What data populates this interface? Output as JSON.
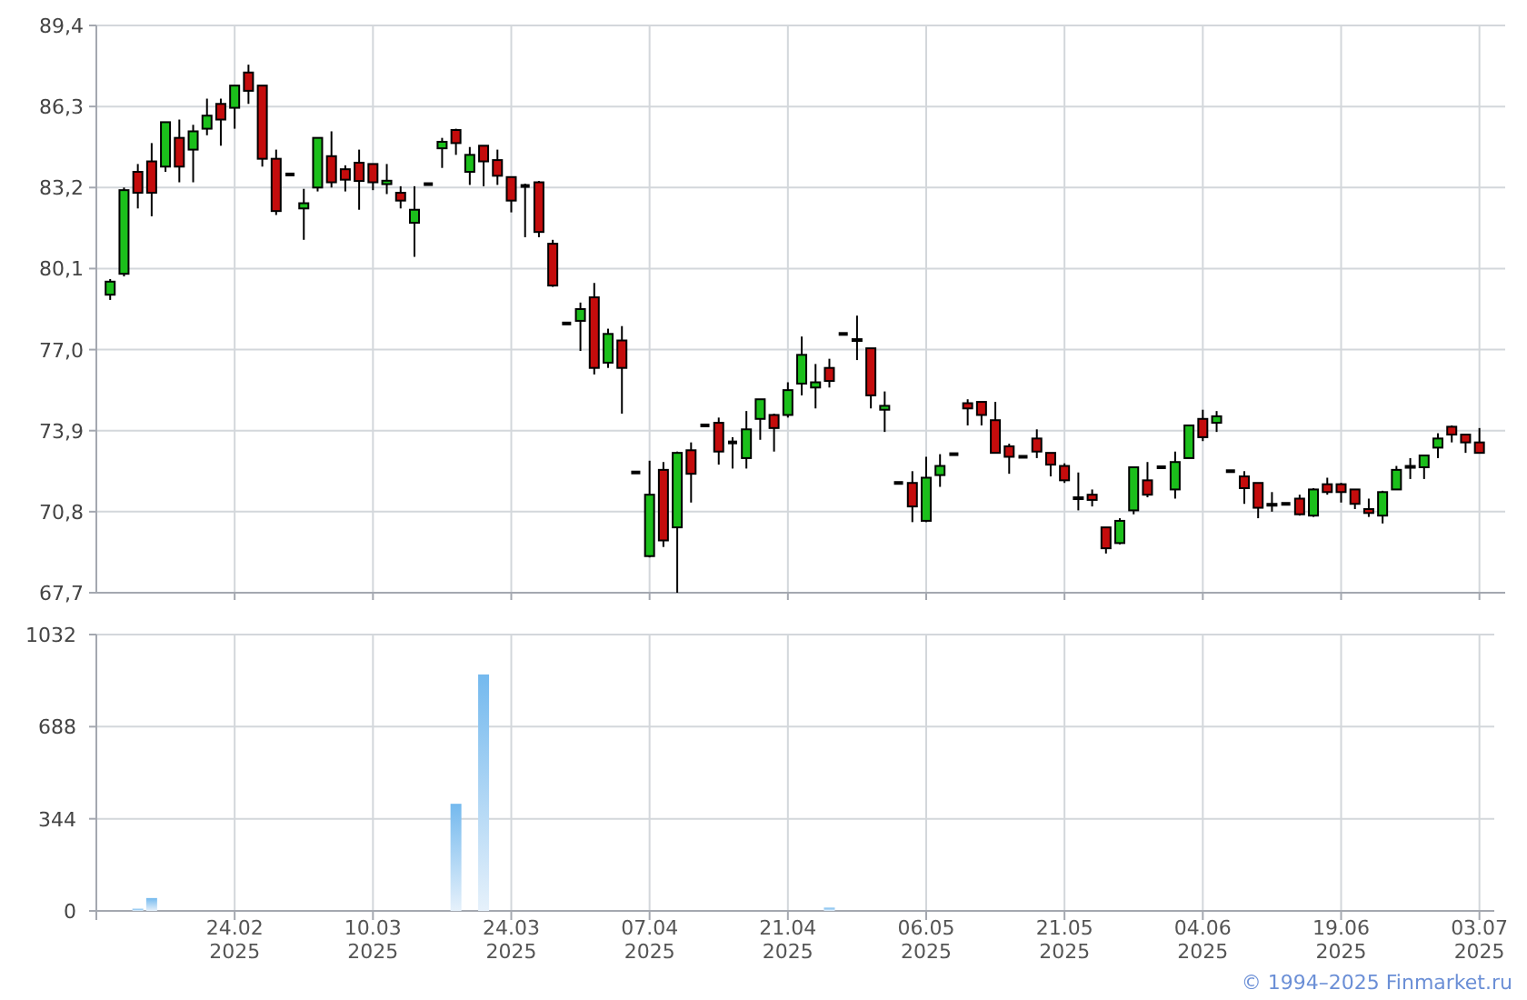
{
  "price_chart": {
    "chart_data": {
      "type": "candlestick",
      "grid": true,
      "categories": [
        null,
        null,
        null,
        null,
        null,
        null,
        null,
        null,
        null,
        null,
        null,
        null,
        null,
        null,
        null,
        null,
        null,
        null,
        null,
        null,
        null,
        null,
        null,
        null,
        null,
        null,
        null,
        null,
        null,
        null,
        null,
        null,
        null,
        null,
        null,
        null,
        null,
        null,
        null,
        null,
        null,
        null,
        null,
        null,
        null,
        null,
        null,
        null,
        null,
        null,
        null,
        null,
        null,
        null,
        null,
        null,
        null,
        null,
        null,
        null,
        null,
        null,
        null,
        null,
        null,
        null,
        null,
        null,
        null,
        null,
        null,
        null,
        null,
        null,
        null,
        null,
        null,
        null,
        null,
        null,
        null,
        null,
        null,
        null,
        null,
        null,
        null,
        null,
        null,
        null,
        null,
        null,
        null,
        null,
        null,
        null,
        null,
        null,
        null,
        null
      ],
      "ohlc": [
        [
          79.1,
          79.7,
          78.9,
          79.6
        ],
        [
          79.9,
          83.2,
          79.8,
          83.1
        ],
        [
          83.8,
          84.1,
          82.4,
          83.0
        ],
        [
          84.2,
          84.9,
          82.1,
          83.0
        ],
        [
          84.0,
          85.7,
          83.8,
          85.7
        ],
        [
          85.1,
          85.8,
          83.4,
          84.0
        ],
        [
          84.65,
          85.6,
          83.4,
          85.35
        ],
        [
          85.45,
          86.6,
          85.2,
          85.95
        ],
        [
          86.4,
          86.6,
          84.8,
          85.8
        ],
        [
          86.25,
          87.1,
          85.45,
          87.1
        ],
        [
          87.6,
          87.9,
          86.4,
          86.9
        ],
        [
          87.1,
          87.1,
          84.0,
          84.3
        ],
        [
          84.3,
          84.65,
          82.15,
          82.3
        ],
        [
          83.7,
          83.7,
          83.7,
          83.7
        ],
        [
          82.4,
          83.15,
          81.2,
          82.6
        ],
        [
          83.2,
          85.1,
          83.05,
          85.1
        ],
        [
          84.4,
          85.35,
          83.2,
          83.4
        ],
        [
          83.9,
          84.05,
          83.05,
          83.5
        ],
        [
          84.15,
          84.65,
          82.35,
          83.45
        ],
        [
          84.1,
          84.1,
          83.1,
          83.4
        ],
        [
          83.33,
          84.1,
          82.95,
          83.46
        ],
        [
          83.0,
          83.25,
          82.4,
          82.7
        ],
        [
          81.85,
          83.25,
          80.55,
          82.35
        ],
        [
          83.33,
          83.33,
          83.33,
          83.33
        ],
        [
          84.7,
          85.1,
          83.95,
          84.95
        ],
        [
          85.4,
          85.45,
          84.45,
          84.9
        ],
        [
          83.8,
          84.75,
          83.3,
          84.45
        ],
        [
          84.8,
          84.8,
          83.25,
          84.2
        ],
        [
          84.25,
          84.65,
          83.3,
          83.65
        ],
        [
          83.6,
          83.6,
          82.25,
          82.7
        ],
        [
          83.26,
          83.35,
          81.3,
          83.26
        ],
        [
          83.4,
          83.45,
          81.3,
          81.5
        ],
        [
          81.05,
          81.2,
          79.4,
          79.45
        ],
        [
          78.0,
          78.0,
          78.0,
          78.0
        ],
        [
          78.1,
          78.8,
          76.95,
          78.55
        ],
        [
          79.0,
          79.55,
          76.05,
          76.3
        ],
        [
          76.5,
          77.8,
          76.3,
          77.6
        ],
        [
          77.35,
          77.9,
          74.55,
          76.3
        ],
        [
          72.3,
          72.3,
          72.3,
          72.3
        ],
        [
          69.1,
          72.75,
          69.05,
          71.45
        ],
        [
          72.4,
          72.7,
          69.45,
          69.7
        ],
        [
          70.2,
          73.1,
          67.7,
          73.05
        ],
        [
          73.15,
          73.45,
          71.15,
          72.25
        ],
        [
          74.1,
          74.1,
          74.1,
          74.1
        ],
        [
          74.2,
          74.4,
          72.6,
          73.1
        ],
        [
          73.42,
          73.65,
          72.45,
          73.45
        ],
        [
          72.85,
          74.65,
          72.45,
          73.95
        ],
        [
          74.35,
          75.1,
          73.55,
          75.1
        ],
        [
          74.5,
          74.55,
          73.1,
          74.0
        ],
        [
          74.5,
          75.75,
          74.4,
          75.45
        ],
        [
          75.7,
          77.5,
          75.25,
          76.8
        ],
        [
          75.55,
          76.45,
          74.75,
          75.75
        ],
        [
          76.3,
          76.65,
          75.55,
          75.8
        ],
        [
          77.6,
          77.6,
          77.6,
          77.6
        ],
        [
          77.4,
          78.3,
          76.6,
          77.35
        ],
        [
          77.05,
          77.05,
          74.75,
          75.25
        ],
        [
          74.7,
          75.4,
          73.85,
          74.85
        ],
        [
          71.9,
          71.9,
          71.9,
          71.9
        ],
        [
          71.9,
          72.35,
          70.4,
          71.0
        ],
        [
          70.45,
          72.9,
          70.4,
          72.1
        ],
        [
          72.2,
          73.0,
          71.75,
          72.55
        ],
        [
          73.0,
          73.0,
          73.0,
          73.0
        ],
        [
          74.95,
          75.1,
          74.1,
          74.75
        ],
        [
          75.0,
          75.0,
          74.1,
          74.5
        ],
        [
          74.3,
          75.0,
          73.05,
          73.05
        ],
        [
          73.3,
          73.4,
          72.25,
          72.9
        ],
        [
          72.9,
          72.9,
          72.9,
          72.9
        ],
        [
          73.6,
          73.95,
          72.85,
          73.1
        ],
        [
          73.05,
          73.05,
          72.15,
          72.6
        ],
        [
          72.55,
          72.65,
          71.9,
          72.0
        ],
        [
          71.35,
          72.3,
          70.85,
          71.3
        ],
        [
          71.45,
          71.65,
          71.0,
          71.25
        ],
        [
          70.2,
          70.2,
          69.2,
          69.4
        ],
        [
          69.6,
          70.55,
          69.55,
          70.45
        ],
        [
          70.85,
          72.5,
          70.7,
          72.5
        ],
        [
          72.0,
          72.7,
          71.35,
          71.45
        ],
        [
          72.5,
          72.5,
          72.5,
          72.5
        ],
        [
          71.65,
          73.1,
          71.3,
          72.7
        ],
        [
          72.85,
          74.1,
          72.85,
          74.1
        ],
        [
          74.35,
          74.7,
          73.5,
          73.65
        ],
        [
          74.2,
          74.65,
          73.85,
          74.45
        ],
        [
          72.35,
          72.35,
          72.35,
          72.35
        ],
        [
          72.15,
          72.35,
          71.1,
          71.7
        ],
        [
          71.9,
          71.9,
          70.55,
          70.95
        ],
        [
          71.1,
          71.55,
          70.8,
          71.05
        ],
        [
          71.1,
          71.1,
          71.1,
          71.1
        ],
        [
          71.3,
          71.45,
          70.65,
          70.7
        ],
        [
          70.65,
          71.7,
          70.6,
          71.65
        ],
        [
          71.85,
          72.1,
          71.45,
          71.55
        ],
        [
          71.85,
          71.9,
          71.15,
          71.55
        ],
        [
          71.65,
          71.65,
          70.9,
          71.1
        ],
        [
          70.9,
          71.3,
          70.6,
          70.75
        ],
        [
          70.65,
          71.6,
          70.35,
          71.55
        ],
        [
          71.65,
          72.55,
          71.65,
          72.4
        ],
        [
          72.5,
          72.85,
          72.05,
          72.55
        ],
        [
          72.5,
          72.95,
          72.05,
          72.95
        ],
        [
          73.25,
          73.8,
          72.85,
          73.6
        ],
        [
          74.05,
          74.1,
          73.45,
          73.75
        ],
        [
          73.75,
          73.75,
          73.05,
          73.45
        ],
        [
          73.45,
          74.0,
          73.05,
          73.05
        ]
      ],
      "ylim": [
        67.7,
        89.4
      ],
      "yticks": [
        {
          "value": 67.7,
          "label": "67,7"
        },
        {
          "value": 70.8,
          "label": "70,8"
        },
        {
          "value": 73.9,
          "label": "73,9"
        },
        {
          "value": 77.0,
          "label": "77,0"
        },
        {
          "value": 80.1,
          "label": "80,1"
        },
        {
          "value": 83.2,
          "label": "83,2"
        },
        {
          "value": 86.3,
          "label": "86,3"
        },
        {
          "value": 89.4,
          "label": "89,4"
        }
      ]
    }
  },
  "volume_chart": {
    "chart_data": {
      "type": "bar",
      "grid": true,
      "categories": [
        null,
        null,
        null,
        null,
        null,
        null,
        null,
        null,
        null,
        "24.02 2025",
        null,
        null,
        null,
        null,
        null,
        null,
        null,
        null,
        null,
        "10.03 2025",
        null,
        null,
        null,
        null,
        null,
        null,
        null,
        null,
        null,
        "24.03 2025",
        null,
        null,
        null,
        null,
        null,
        null,
        null,
        null,
        null,
        "07.04 2025",
        null,
        null,
        null,
        null,
        null,
        null,
        null,
        null,
        null,
        "21.04 2025",
        null,
        null,
        null,
        null,
        null,
        null,
        null,
        null,
        null,
        "06.05 2025",
        null,
        null,
        null,
        null,
        null,
        null,
        null,
        null,
        null,
        "21.05 2025",
        null,
        null,
        null,
        null,
        null,
        null,
        null,
        null,
        null,
        "04.06 2025",
        null,
        null,
        null,
        null,
        null,
        null,
        null,
        null,
        null,
        "19.06 2025",
        null,
        null,
        null,
        null,
        null,
        null,
        null,
        null,
        null,
        "03.07 2025"
      ],
      "series": [
        {
          "color": "#74b9ee",
          "values": [
            0,
            0,
            8,
            48,
            0,
            0,
            0,
            0,
            0,
            0,
            0,
            0,
            0,
            0,
            0,
            0,
            0,
            0,
            0,
            0,
            0,
            0,
            0,
            0,
            0,
            400,
            0,
            883,
            0,
            0,
            0,
            0,
            0,
            0,
            0,
            0,
            0,
            0,
            0,
            0,
            0,
            0,
            0,
            0,
            0,
            0,
            0,
            0,
            0,
            0,
            0,
            0,
            12,
            0,
            0,
            0,
            0,
            0,
            0,
            0,
            0,
            0,
            0,
            0,
            0,
            0,
            0,
            0,
            0,
            0,
            0,
            0,
            0,
            0,
            0,
            0,
            0,
            0,
            0,
            0,
            0,
            0,
            0,
            0,
            0,
            0,
            0,
            0,
            0,
            0,
            0,
            0,
            0,
            0,
            0,
            0,
            0,
            0,
            0,
            0
          ]
        }
      ],
      "ylim": [
        0,
        1032
      ],
      "yticks": [
        0,
        344,
        688,
        1032
      ]
    }
  },
  "credit": "© 1994–2025 Finmarket.ru"
}
